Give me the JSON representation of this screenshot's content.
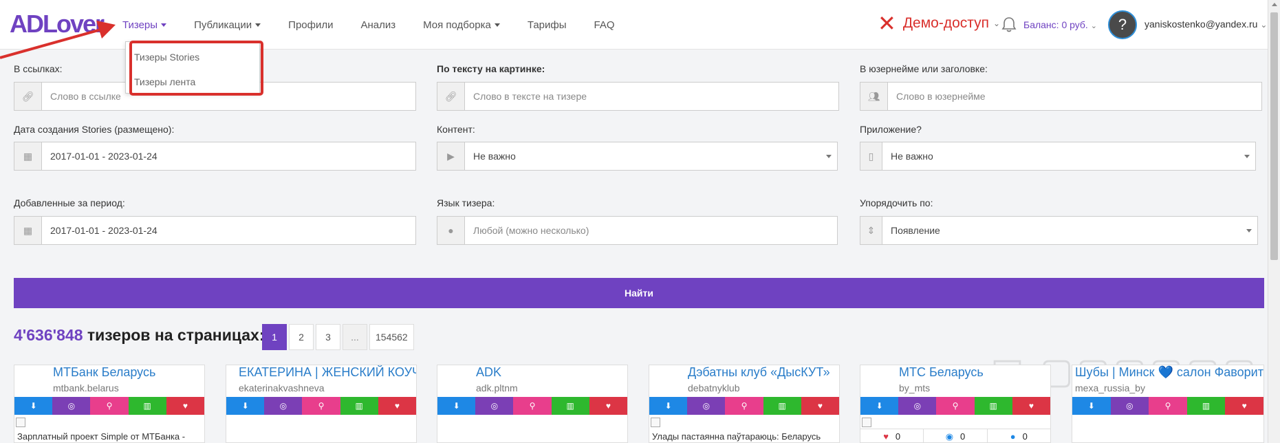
{
  "header": {
    "logo": "ADLover",
    "nav": [
      {
        "label": "Тизеры",
        "dropdown": true,
        "active": true
      },
      {
        "label": "Публикации",
        "dropdown": true
      },
      {
        "label": "Профили"
      },
      {
        "label": "Анализ"
      },
      {
        "label": "Моя подборка",
        "dropdown": true
      },
      {
        "label": "Тарифы"
      },
      {
        "label": "FAQ"
      }
    ],
    "demo": "Демо-доступ",
    "balance": "Баланс: 0 руб.",
    "avatar_text": "?",
    "email": "yaniskostenko@yandex.ru"
  },
  "dropdown": {
    "items": [
      "Тизеры Stories",
      "Тизеры лента"
    ]
  },
  "filters": {
    "links_label": "В ссылках:",
    "links_placeholder": "Слово в ссылке",
    "image_text_label": "По тексту на картинке:",
    "image_text_placeholder": "Слово в тексте на тизере",
    "username_label": "В юзернейме или заголовке:",
    "username_placeholder": "Слово в юзернейме",
    "created_label": "Дата создания Stories (размещено):",
    "created_value": "2017-01-01 - 2023-01-24",
    "content_label": "Контент:",
    "content_value": "Не важно",
    "app_label": "Приложение?",
    "app_value": "Не важно",
    "added_label": "Добавленные за период:",
    "added_value": "2017-01-01 - 2023-01-24",
    "lang_label": "Язык тизера:",
    "lang_placeholder": "Любой (можно несколько)",
    "sort_label": "Упорядочить по:",
    "sort_value": "Появление",
    "search_button": "Найти"
  },
  "results": {
    "count": "4'636'848",
    "suffix": "тизеров на страницах:",
    "pages": [
      "1",
      "2",
      "3",
      "...",
      "154562"
    ]
  },
  "cards": [
    {
      "name": "МТБанк Беларусь",
      "handle": "mtbank.belarus",
      "desc": "Зарплатный проект Simple от МТБанка -"
    },
    {
      "name": "ЕКАТЕРИНА | ЖЕНСКИЙ КОУЧ",
      "handle": "ekaterinakvashneva",
      "desc": ""
    },
    {
      "name": "ADK",
      "handle": "adk.pltnm",
      "desc": ""
    },
    {
      "name": "Дэбатны клуб «ДысКУТ»",
      "handle": "debatnyklub",
      "desc": "Улады пастаянна паўтараюць: Беларусь"
    },
    {
      "name": "МТС Беларусь",
      "handle": "by_mts",
      "stats": [
        "0",
        "0",
        "0"
      ]
    },
    {
      "name": "Шубы | Минск 💙 салон Фаворит",
      "handle": "mexa_russia_by",
      "desc": ""
    }
  ],
  "colors": {
    "accent": "#6f42c1",
    "demo_red": "#d9302c",
    "link_blue": "#2a7dc9"
  }
}
